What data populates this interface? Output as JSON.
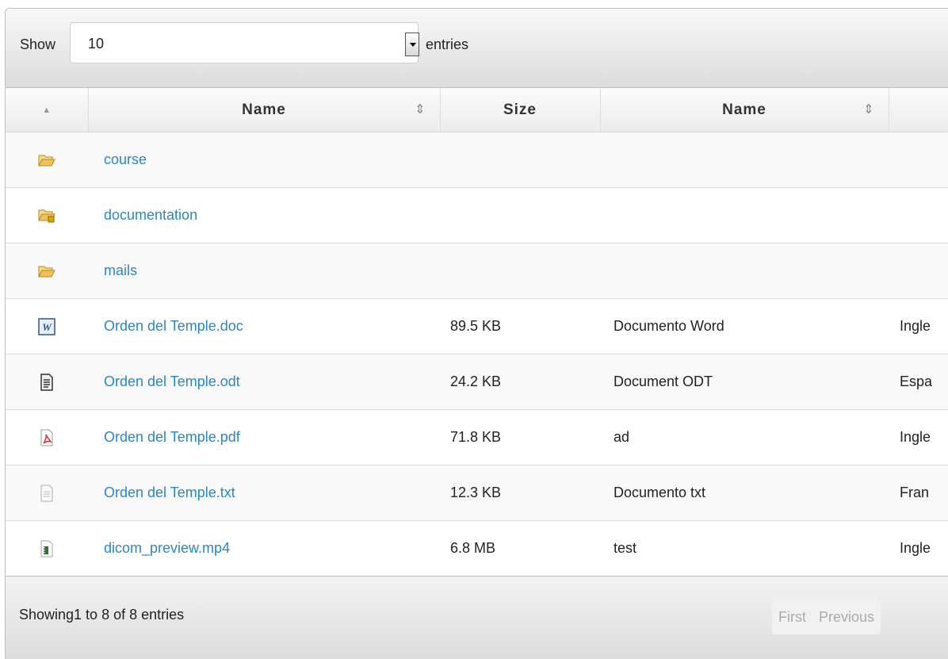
{
  "length_menu": {
    "prefix": "Show",
    "value": "10",
    "suffix": "entries"
  },
  "columns": {
    "icon_sort": "▲",
    "name": "Name",
    "size": "Size",
    "type": "Name",
    "sort_glyph": "⇕"
  },
  "rows": [
    {
      "icon": "folder-open-icon",
      "name": "course",
      "size": "",
      "type": "",
      "lang": ""
    },
    {
      "icon": "folder-locked-icon",
      "name": "documentation",
      "size": "",
      "type": "",
      "lang": ""
    },
    {
      "icon": "folder-open-icon",
      "name": "mails",
      "size": "",
      "type": "",
      "lang": ""
    },
    {
      "icon": "word-doc-icon",
      "name": "Orden del Temple.doc",
      "size": "89.5 KB",
      "type": "Documento Word",
      "lang": "Ingle"
    },
    {
      "icon": "odt-doc-icon",
      "name": "Orden del Temple.odt",
      "size": "24.2 KB",
      "type": "Document ODT",
      "lang": "Espa"
    },
    {
      "icon": "pdf-icon",
      "name": "Orden del Temple.pdf",
      "size": "71.8 KB",
      "type": "ad",
      "lang": "Ingle"
    },
    {
      "icon": "text-file-icon",
      "name": "Orden del Temple.txt",
      "size": "12.3 KB",
      "type": "Documento txt",
      "lang": "Fran"
    },
    {
      "icon": "video-file-icon",
      "name": "dicom_preview.mp4",
      "size": "6.8 MB",
      "type": "test",
      "lang": "Ingle"
    }
  ],
  "footer": {
    "info": "Showing1 to 8 of 8 entries",
    "first": "First",
    "previous": "Previous"
  },
  "colors": {
    "link": "#2a87c6",
    "folder": "#f0c060",
    "word": "#2b579a",
    "pdf": "#d9342b"
  }
}
